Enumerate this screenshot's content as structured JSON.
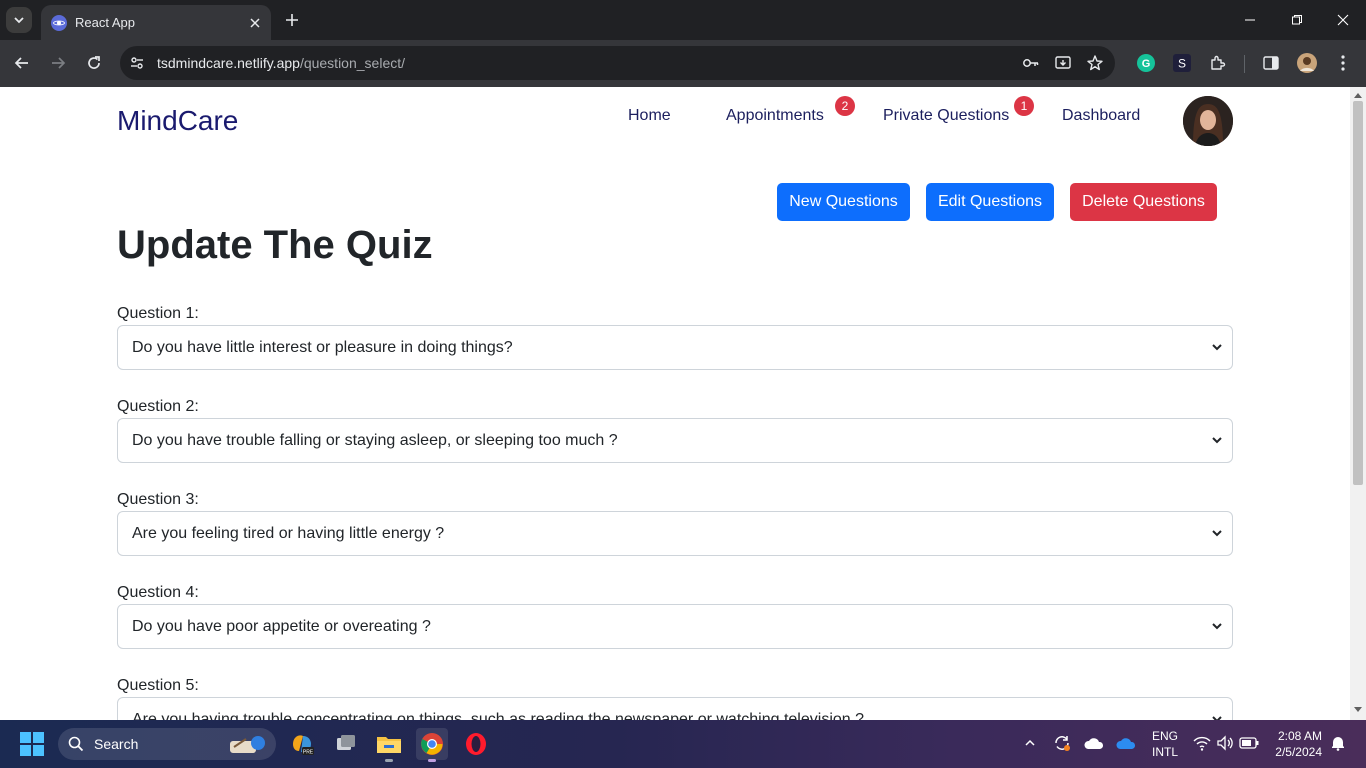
{
  "browser": {
    "tab_title": "React App",
    "url_host": "tsdmindcare.netlify.app",
    "url_path": "/question_select/"
  },
  "navbar": {
    "brand": "MindCare",
    "links": [
      {
        "label": "Home"
      },
      {
        "label": "Appointments",
        "badge": "2"
      },
      {
        "label": "Private Questions",
        "badge": "1"
      },
      {
        "label": "Dashboard"
      }
    ]
  },
  "actions": {
    "new": "New Questions",
    "edit": "Edit Questions",
    "delete": "Delete Questions"
  },
  "page_title": "Update The Quiz",
  "questions": [
    {
      "label": "Question 1:",
      "value": "Do you have little interest or pleasure in doing things?"
    },
    {
      "label": "Question 2:",
      "value": "Do you have trouble falling or staying asleep, or sleeping too much ?"
    },
    {
      "label": "Question 3:",
      "value": "Are you feeling tired or having little energy ?"
    },
    {
      "label": "Question 4:",
      "value": "Do you have poor appetite or overeating ?"
    },
    {
      "label": "Question 5:",
      "value": "Are you having trouble concentrating on things, such as reading the newspaper or watching television ?"
    }
  ],
  "taskbar": {
    "search_label": "Search",
    "lang_line1": "ENG",
    "lang_line2": "INTL",
    "time": "2:08 AM",
    "date": "2/5/2024"
  },
  "colors": {
    "brand": "#1a1a6e",
    "primary_button": "#0d6efd",
    "danger_button": "#dc3545",
    "badge": "#dc3545"
  }
}
